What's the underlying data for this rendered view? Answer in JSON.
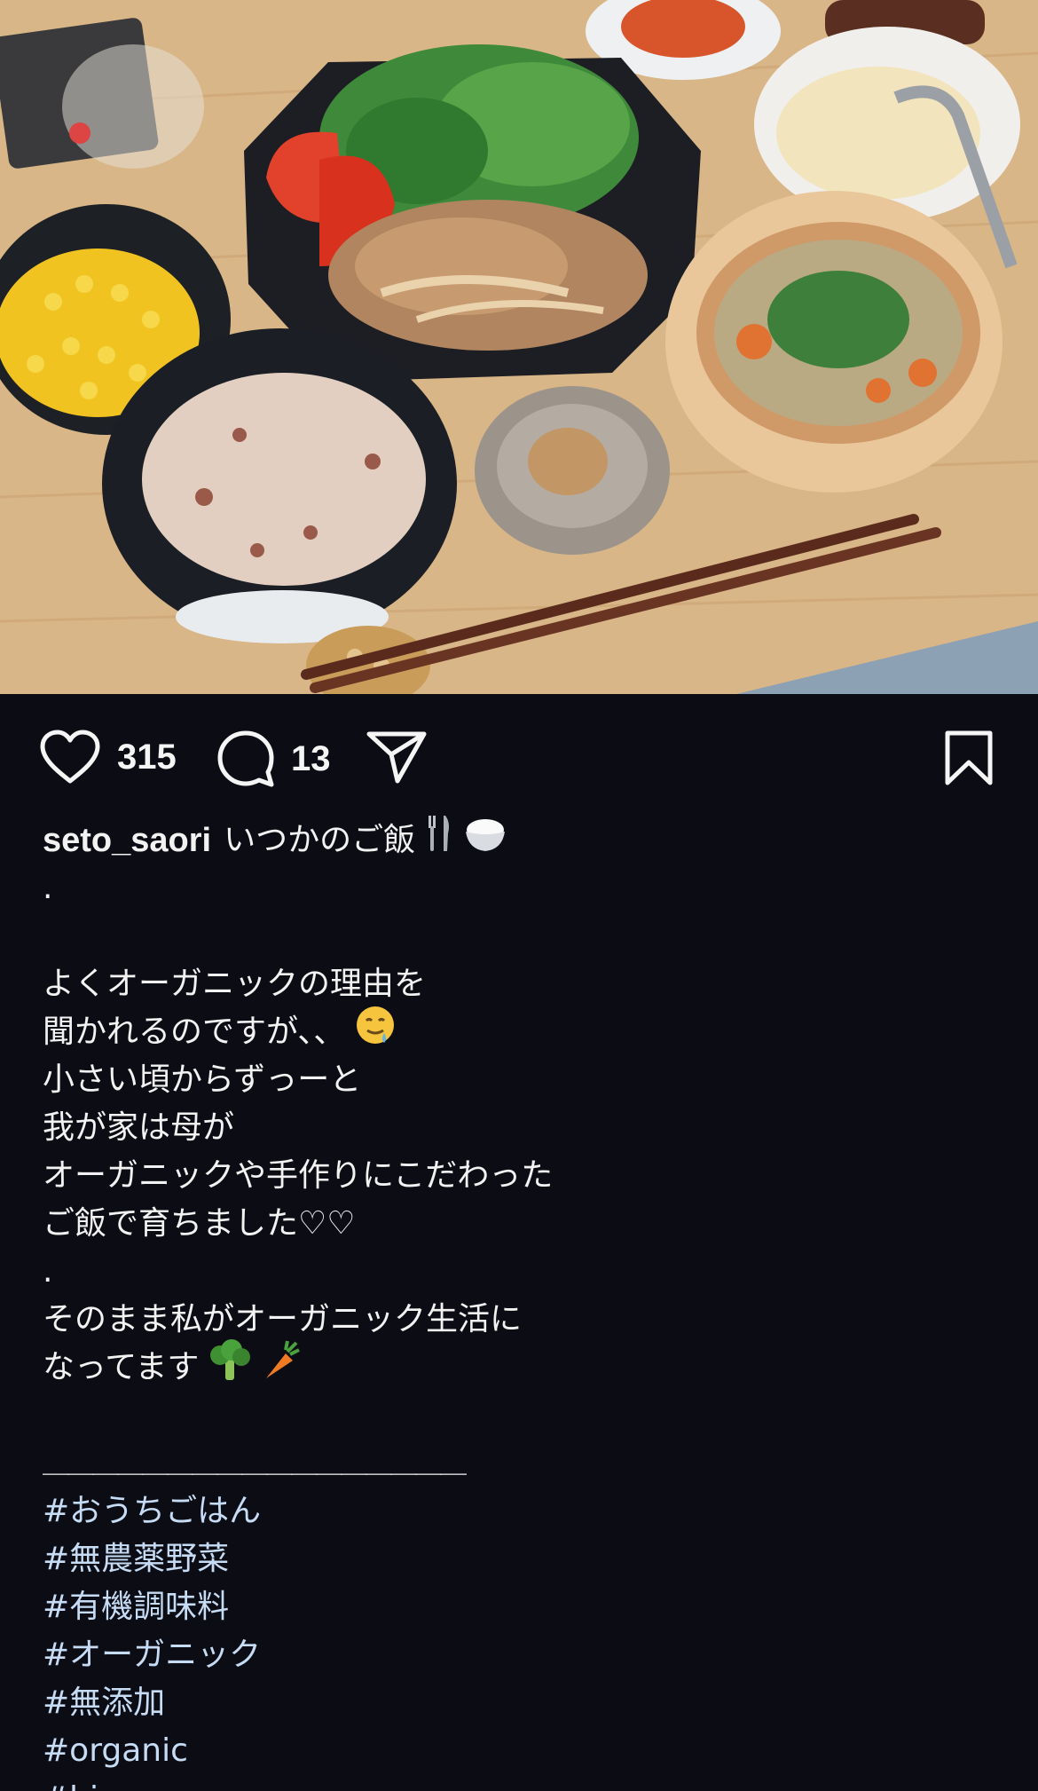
{
  "post": {
    "likes": "315",
    "comments": "13",
    "username": "seto_saori",
    "first_line": "いつかのご飯",
    "caption_lines": [
      ".",
      "",
      "よくオーガニックの理由を",
      "聞かれるのですが、、",
      "小さい頃からずっーと",
      "我が家は母が",
      "オーガニックや手作りにこだわった",
      "ご飯で育ちました♡♡",
      ".",
      "そのまま私がオーガニック生活に",
      "なってます"
    ],
    "divider": "＿＿＿＿＿＿＿＿＿＿＿＿＿＿＿＿＿",
    "hashtags": [
      "#おうちごはん",
      "#無農薬野菜",
      "#有機調味料",
      "#オーガニック",
      "#無添加",
      "#organic",
      "#bio"
    ]
  },
  "icons": {
    "like": "heart-icon",
    "comment": "comment-bubble-icon",
    "share": "paper-plane-icon",
    "bookmark": "bookmark-icon",
    "emoji_fork_knife": "fork-and-knife-emoji",
    "emoji_rice": "rice-bowl-emoji",
    "emoji_drool": "drooling-face-emoji",
    "emoji_broccoli": "broccoli-emoji",
    "emoji_carrot": "carrot-emoji"
  },
  "colors": {
    "background": "#0c0c14",
    "hashtag": "#c6dcf5",
    "text": "#f2f2f2"
  }
}
